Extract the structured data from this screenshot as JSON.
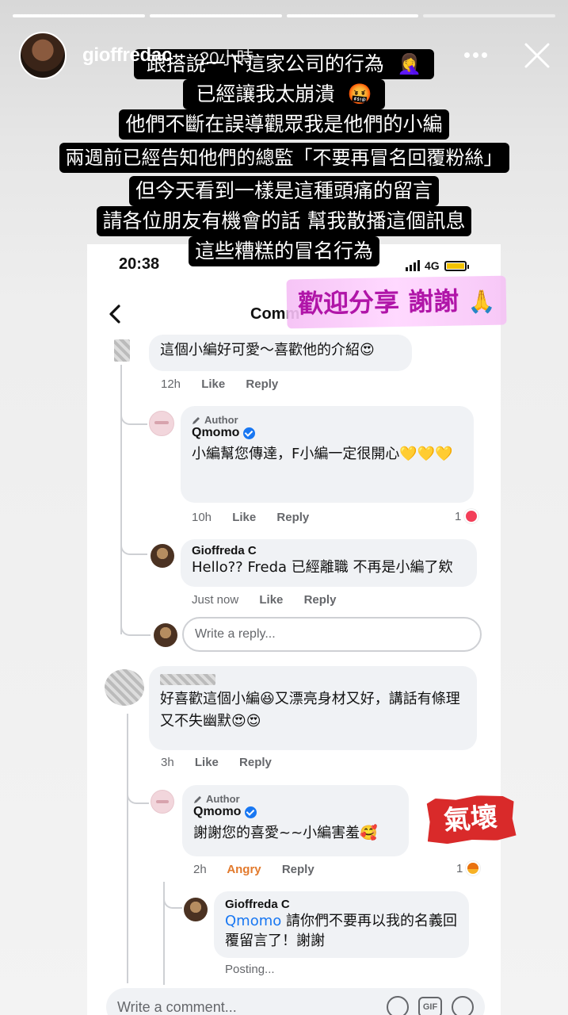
{
  "story": {
    "username": "gioffredac",
    "time": "20小時",
    "caption_lines": [
      "跟搭說一下這家公司的行為",
      "已經讓我太崩潰",
      "他們不斷在誤導觀眾我是他們的小編",
      "兩週前已經告知他們的總監「不要再冒名回覆粉絲」",
      "但今天看到一樣是這種頭痛的留言",
      "請各位朋友有機會的話 幫我散播這個訊息",
      "這些糟糕的冒名行為"
    ],
    "caption_emojis": [
      "🤦‍♀️",
      "🤬"
    ],
    "share_sticker": "歡迎分享 謝謝",
    "share_sticker_emoji": "🙏",
    "angry_sticker": "氣壞"
  },
  "phone": {
    "time": "20:38",
    "network": "4G",
    "header_title": "Comm"
  },
  "comments": {
    "c1": {
      "text": "這個小編好可愛～喜歡他的介紹😍",
      "time": "12h",
      "like": "Like",
      "reply": "Reply"
    },
    "r1": {
      "author_tag": "Author",
      "name": "Qmomo",
      "text": "小編幫您傳達，F小編一定很開心💛💛💛",
      "time": "10h",
      "like": "Like",
      "reply": "Reply",
      "react_count": "1"
    },
    "r2": {
      "name": "Gioffreda C",
      "text": "Hello?? Freda 已經離職 不再是小編了欸",
      "time": "Just now",
      "like": "Like",
      "reply": "Reply"
    },
    "reply_placeholder": "Write a reply...",
    "c2": {
      "text": "好喜歡這個小編😆又漂亮身材又好，講話有條理又不失幽默😍😍",
      "time": "3h",
      "like": "Like",
      "reply": "Reply"
    },
    "r3": {
      "author_tag": "Author",
      "name": "Qmomo",
      "text": "謝謝您的喜愛~~小編害羞🥰",
      "time": "2h",
      "reaction_label": "Angry",
      "reply": "Reply",
      "react_count": "1"
    },
    "r4": {
      "name": "Gioffreda C",
      "mention": "Qmomo",
      "text": "請你們不要再以我的名義回覆留言了！謝謝",
      "status": "Posting..."
    }
  },
  "comment_bar": {
    "placeholder": "Write a comment...",
    "gif_label": "GIF"
  },
  "colors": {
    "link_blue": "#1877f2",
    "angry_orange": "#e27a2d",
    "sticker_pink": "#b015a8",
    "sticker_red": "#d92a2a"
  }
}
